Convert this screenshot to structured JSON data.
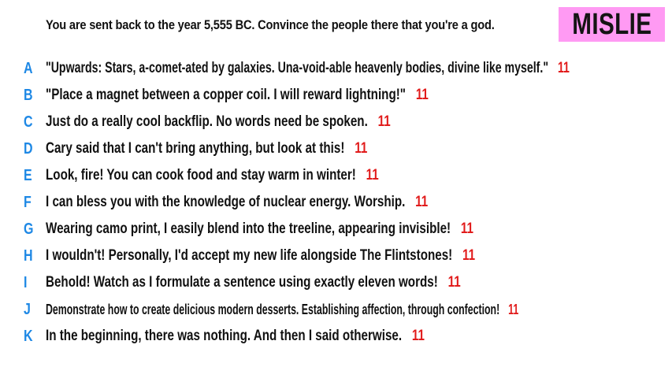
{
  "prompt": "You are sent back to the year 5,555 BC. Convince the people there that you're a god.",
  "badge": "MISLIE",
  "colors": {
    "letter": "#1e88e5",
    "count": "#e11b1b",
    "badge_bg": "#ff9af3"
  },
  "answers": [
    {
      "letter": "A",
      "text": "\"Upwards: Stars, a-comet-ated by galaxies. Una-void-able heavenly bodies, divine like myself.\"",
      "count": "11"
    },
    {
      "letter": "B",
      "text": "\"Place a magnet between a copper coil. I will reward lightning!\"",
      "count": "11"
    },
    {
      "letter": "C",
      "text": "Just do a really cool backflip. No words need be spoken.",
      "count": "11"
    },
    {
      "letter": "D",
      "text": "Cary said that I can't bring anything, but look at this!",
      "count": "11"
    },
    {
      "letter": "E",
      "text": "Look, fire! You can cook food and stay warm in winter!",
      "count": "11"
    },
    {
      "letter": "F",
      "text": "I can bless you with the knowledge of nuclear energy. Worship.",
      "count": "11"
    },
    {
      "letter": "G",
      "text": "Wearing camo print, I easily blend into the treeline, appearing invisible!",
      "count": "11"
    },
    {
      "letter": "H",
      "text": "I wouldn't! Personally, I'd accept my new life alongside The Flintstones!",
      "count": "11"
    },
    {
      "letter": "I",
      "text": "Behold! Watch as I formulate a sentence using exactly eleven words!",
      "count": "11"
    },
    {
      "letter": "J",
      "text": "Demonstrate how to create delicious modern desserts. Establishing affection, through confection!",
      "count": "11"
    },
    {
      "letter": "K",
      "text": "In the beginning, there was nothing. And then I said otherwise.",
      "count": "11"
    }
  ]
}
